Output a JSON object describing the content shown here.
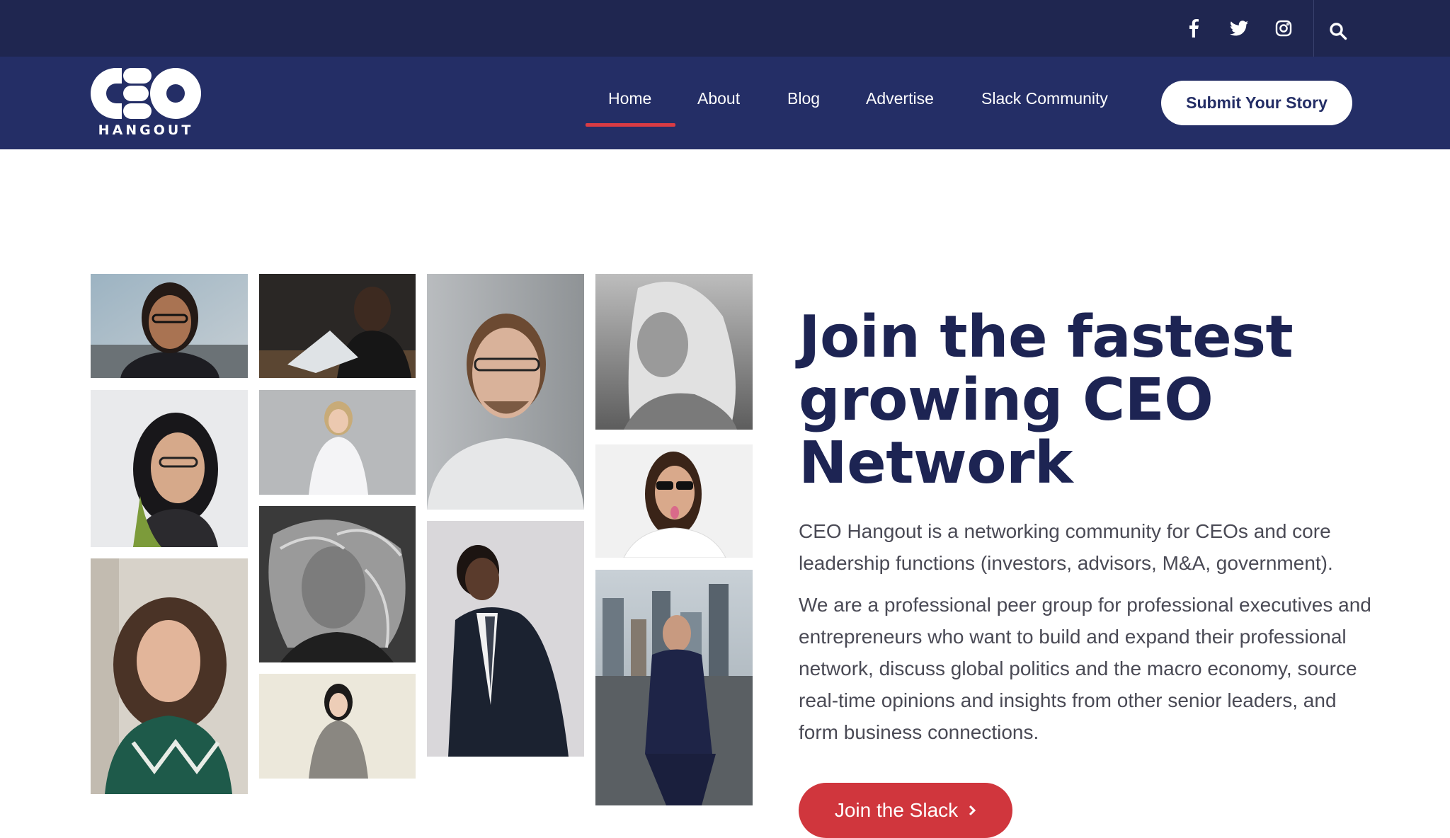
{
  "topbar": {
    "social_icons": [
      "facebook-icon",
      "twitter-icon",
      "instagram-icon"
    ],
    "search_icon": "search-icon"
  },
  "logo": {
    "word": "CEO",
    "subtitle": "HANGOUT"
  },
  "nav": {
    "items": [
      {
        "label": "Home",
        "active": true
      },
      {
        "label": "About"
      },
      {
        "label": "Blog"
      },
      {
        "label": "Advertise"
      },
      {
        "label": "Slack Community"
      }
    ],
    "cta": "Submit Your Story"
  },
  "hero": {
    "headline": "Join the fastest growing CEO Network",
    "paragraph1": "CEO Hangout is a networking community for CEOs and core leadership functions (investors, advisors, M&A, government).",
    "paragraph2": "We are a professional peer group for professional executives and entrepreneurs who want to build and expand their professional network, discuss global politics and the macro economy, source real-time opinions and insights from other senior leaders, and form business connections.",
    "button_label": "Join the Slack",
    "button_icon": "chevron-right-icon"
  },
  "colors": {
    "topbar": "#1f2650",
    "navbar": "#242e66",
    "accent": "#d93b44",
    "headline": "#1d2453",
    "body_text": "#4a4a55"
  }
}
